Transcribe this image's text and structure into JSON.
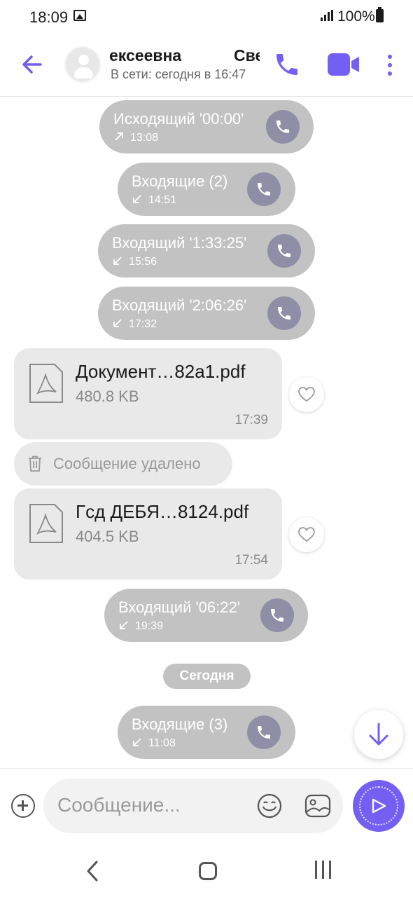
{
  "status_bar": {
    "time": "18:09",
    "battery": "100%"
  },
  "header": {
    "contact_name_part1": "ексеевна",
    "contact_name_part2": "Све",
    "contact_status": "В сети: сегодня в 16:47",
    "accent_color": "#7360f2"
  },
  "messages": {
    "call1": {
      "title": "Исходящий '00:00'",
      "time": "13:08",
      "direction": "outgoing"
    },
    "call2": {
      "title": "Входящие (2)",
      "time": "14:51",
      "direction": "incoming"
    },
    "call3": {
      "title": "Входящий '1:33:25'",
      "time": "15:56",
      "direction": "incoming"
    },
    "call4": {
      "title": "Входящий '2:06:26'",
      "time": "17:32",
      "direction": "incoming"
    },
    "file1": {
      "name": "Документ…82a1.pdf",
      "size": "480.8 KB",
      "time": "17:39"
    },
    "deleted": {
      "text": "Сообщение удалено"
    },
    "file2": {
      "name": "Гсд ДЕБЯ…8124.pdf",
      "size": "404.5 KB",
      "time": "17:54"
    },
    "call5": {
      "title": "Входящий '06:22'",
      "time": "19:39",
      "direction": "incoming"
    },
    "date_separator": "Сегодня",
    "call6": {
      "title": "Входящие (3)",
      "time": "11:08",
      "direction": "incoming"
    }
  },
  "composer": {
    "placeholder": "Сообщение..."
  },
  "icons": {
    "back": "arrow-left-icon",
    "call": "phone-icon",
    "video": "video-camera-icon",
    "more": "more-vertical-icon",
    "pdf": "pdf-file-icon",
    "like": "heart-icon",
    "trash": "trash-icon",
    "scroll": "arrow-down-icon",
    "attach": "plus-circle-icon",
    "emoji": "smiley-icon",
    "gallery": "image-icon",
    "send": "send-icon"
  }
}
